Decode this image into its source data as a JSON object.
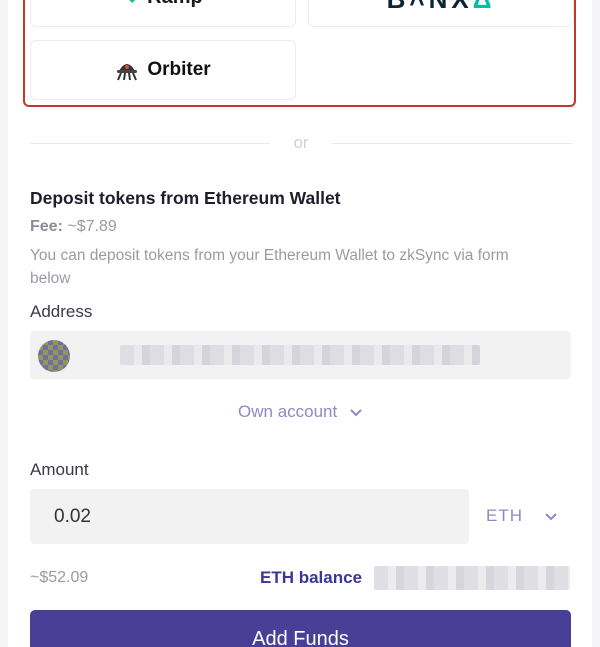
{
  "providers": [
    {
      "name": "Ramp"
    },
    {
      "name": "BANXA"
    },
    {
      "name": "Orbiter"
    }
  ],
  "divider_text": "or",
  "deposit": {
    "title": "Deposit tokens from Ethereum Wallet",
    "fee_label": "Fee:",
    "fee_value": "~$7.89",
    "description": "You can deposit tokens from your Ethereum Wallet to zkSync via form below",
    "address_label": "Address",
    "own_account": "Own account",
    "amount_label": "Amount",
    "amount_value": "0.02",
    "currency": "ETH",
    "usd_value": "~$52.09",
    "balance_label": "ETH balance",
    "submit_label": "Add Funds"
  },
  "colors": {
    "highlight_border": "#c2382a",
    "accent": "#8e88c6",
    "primary_button": "#4a3f97"
  },
  "icons": [
    "ramp-logo-icon",
    "banxa-logo-icon",
    "orbiter-logo-icon",
    "chevron-down-icon",
    "wallet-avatar"
  ]
}
